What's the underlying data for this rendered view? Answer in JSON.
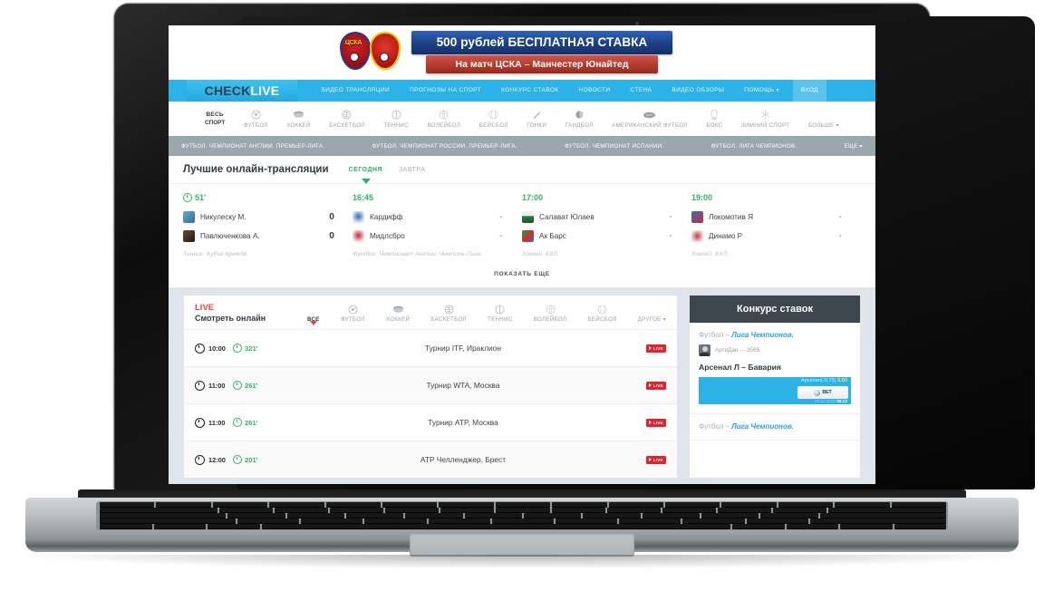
{
  "banner": {
    "headline": "500 рублей БЕСПЛАТНАЯ СТАВКА",
    "subline": "На матч ЦСКА – Манчестер Юнайтед",
    "crest_left": "ЦСКА",
    "crest_right": "MU"
  },
  "topnav": {
    "logo_part1": "CHECK",
    "logo_part2": "LIVE",
    "items": [
      {
        "label": "ВИДЕО ТРАНСЛЯЦИИ"
      },
      {
        "label": "ПРОГНОЗЫ НА СПОРТ"
      },
      {
        "label": "КОНКУРС СТАВОК"
      },
      {
        "label": "НОВОСТИ"
      },
      {
        "label": "СТЕНА"
      },
      {
        "label": "ВИДЕО ОБЗОРЫ"
      },
      {
        "label": "ПОМОЩЬ",
        "caret": "▾"
      }
    ],
    "login": "ВХОД"
  },
  "sportsnav": {
    "items": [
      {
        "label": "ВЕСЬ",
        "label2": "СПОРТ",
        "icon": "all-sports",
        "active": true
      },
      {
        "label": "ФУТБОЛ",
        "icon": "football-icon"
      },
      {
        "label": "ХОККЕЙ",
        "icon": "hockey-puck-icon"
      },
      {
        "label": "БАСКЕТБОЛ",
        "icon": "basketball-icon"
      },
      {
        "label": "ТЕННИС",
        "icon": "tennis-ball-icon"
      },
      {
        "label": "ВОЛЕЙБОЛ",
        "icon": "volleyball-icon"
      },
      {
        "label": "БЕЙСБОЛ",
        "icon": "baseball-icon"
      },
      {
        "label": "ГОНКИ",
        "icon": "racing-icon"
      },
      {
        "label": "ГАНДБОЛ",
        "icon": "handball-icon"
      },
      {
        "label": "АМЕРИКАНСКИЙ ФУТБОЛ",
        "icon": "american-football-icon"
      },
      {
        "label": "БОКС",
        "icon": "boxing-glove-icon"
      },
      {
        "label": "ЗИМНИЙ СПОРТ",
        "icon": "snowflake-icon"
      },
      {
        "label": "БОЛЬШЕ",
        "icon": "chevron-down-icon",
        "caret": "▾"
      }
    ]
  },
  "leaguebar": {
    "items": [
      "ФУТБОЛ. ЧЕМПИОНАТ АНГЛИИ. ПРЕМЬЕР-ЛИГА.",
      "ФУТБОЛ. ЧЕМПИОНАТ РОССИИ. ПРЕМЬЕР-ЛИГА.",
      "ФУТБОЛ. ЧЕМПИОНАТ ИСПАНИИ.",
      "ФУТБОЛ. ЛИГА ЧЕМПИОНОВ."
    ],
    "more": "ЕЩЕ",
    "more_caret": "▾"
  },
  "best": {
    "title": "Лучшие онлайн-трансляции",
    "tabs": [
      {
        "label": "СЕГОДНЯ",
        "active": true
      },
      {
        "label": "ЗАВТРА",
        "active": false
      }
    ],
    "matches": [
      {
        "time": "51'",
        "has_clock": true,
        "league": "Теннис. Кубок Кремля.",
        "rows": [
          {
            "team": "Никулеску М.",
            "score": "0"
          },
          {
            "team": "Павлюченкова А.",
            "score": "0"
          }
        ]
      },
      {
        "time": "16:45",
        "has_clock": false,
        "league": "Футбол. Чемпионат Англии. Чемпион-Лига.",
        "rows": [
          {
            "team": "Кардифф",
            "score": "-"
          },
          {
            "team": "Мидлсбро",
            "score": "-"
          }
        ]
      },
      {
        "time": "17:00",
        "has_clock": false,
        "league": "Хоккей. КХЛ.",
        "rows": [
          {
            "team": "Салават Юлаев",
            "score": "-"
          },
          {
            "team": "Ак Барс",
            "score": "-"
          }
        ]
      },
      {
        "time": "19:00",
        "has_clock": false,
        "league": "Хоккей. КХЛ.",
        "rows": [
          {
            "team": "Локомотив Я",
            "score": "-"
          },
          {
            "team": "Динамо Р",
            "score": "-"
          }
        ]
      }
    ],
    "show_more": "ПОКАЗАТЬ ЕЩЕ"
  },
  "live": {
    "label": "LIVE",
    "sub": "Смотреть онлайн",
    "tabs": [
      {
        "label": "ВСЕ",
        "icon": "none",
        "active": true
      },
      {
        "label": "ФУТБОЛ",
        "icon": "football-icon",
        "active": false
      },
      {
        "label": "ХОККЕЙ",
        "icon": "hockey-puck-icon",
        "active": false
      },
      {
        "label": "БАСКЕТБОЛ",
        "icon": "basketball-icon",
        "active": false
      },
      {
        "label": "ТЕННИС",
        "icon": "tennis-ball-icon",
        "active": false
      },
      {
        "label": "ВОЛЕЙБОЛ",
        "icon": "volleyball-icon",
        "active": false
      },
      {
        "label": "БЕЙСБОЛ",
        "icon": "baseball-icon",
        "active": false
      },
      {
        "label": "ДРУГОЕ",
        "icon": "chevron-down-icon",
        "active": false,
        "caret": "▾"
      }
    ],
    "rows": [
      {
        "time": "10:00",
        "minute": "321'",
        "name": "Турнир ITF, Ираклион",
        "badge": "LIVE"
      },
      {
        "time": "11:00",
        "minute": "261'",
        "name": "Турнир WTA, Москва",
        "badge": "LIVE"
      },
      {
        "time": "11:00",
        "minute": "261'",
        "name": "Турнир ATP, Москва",
        "badge": "LIVE"
      },
      {
        "time": "12:00",
        "minute": "201'",
        "name": "ATP Челленджер, Брест",
        "badge": "LIVE"
      }
    ]
  },
  "contest": {
    "title": "Конкурс ставок",
    "items": [
      {
        "sport": "Футбол",
        "dash": "–",
        "league": "Лига Чемпионов.",
        "user": "АртиДан",
        "user_amount": "– -356$",
        "match": "Арсенал Л – Бавария",
        "pick": "Арсенал(-0.75)",
        "odds": "5.50",
        "bookmaker": "BET",
        "date": "20.10.2015",
        "time": "08:22"
      },
      {
        "sport": "Футбол",
        "dash": "–",
        "league": "Лига Чемпионов."
      }
    ]
  }
}
